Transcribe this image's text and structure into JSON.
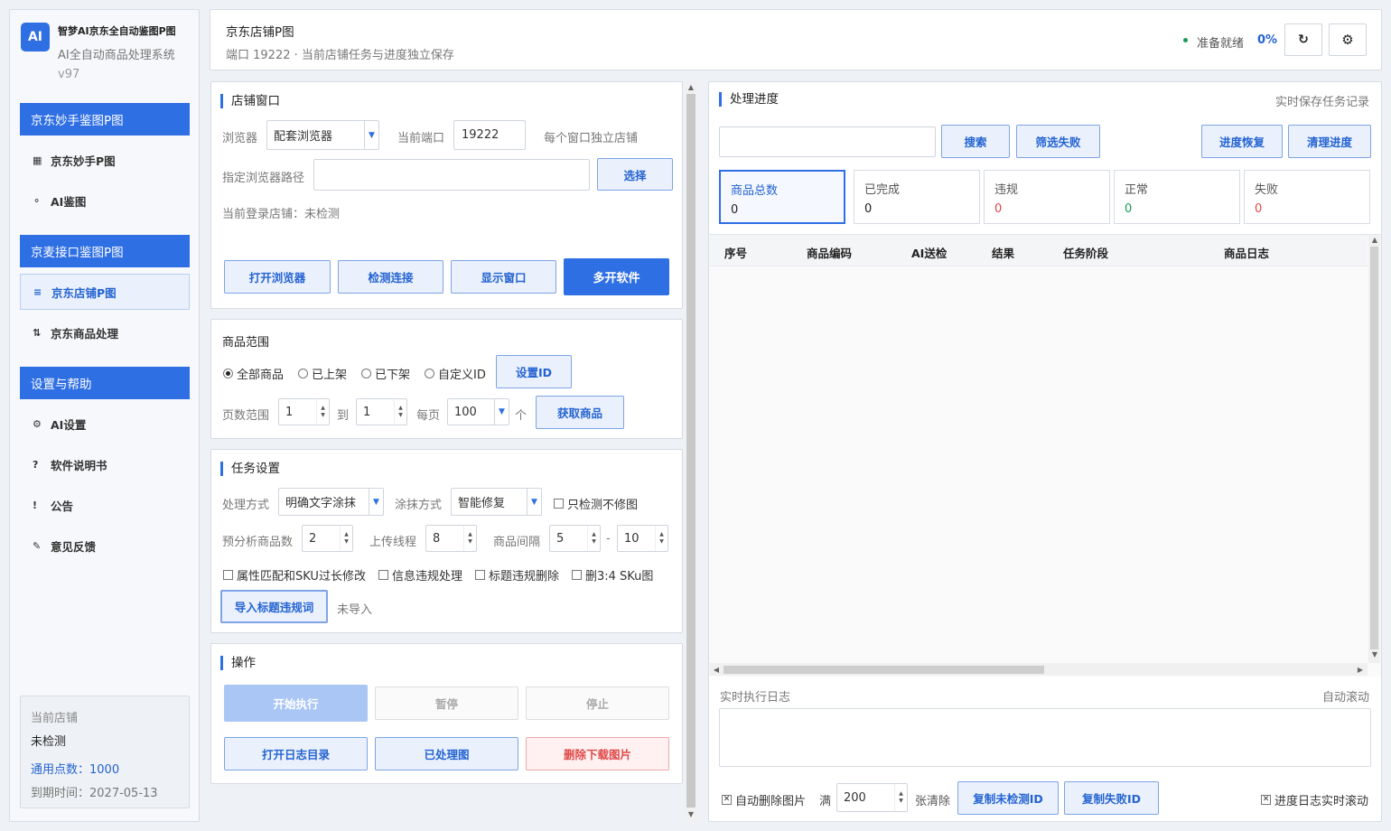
{
  "app": {
    "logo": "AI",
    "title": "智梦AI京东全自动鉴图P图",
    "subtitle": "AI全自动商品处理系统",
    "version": "v97"
  },
  "nav": {
    "group1": {
      "label": "京东妙手鉴图P图",
      "items": [
        {
          "icon": "▦",
          "icon_name": "grid-icon",
          "label": "京东妙手P图"
        },
        {
          "icon": "⚬",
          "icon_name": "circle-icon",
          "label": "AI鉴图"
        }
      ]
    },
    "group2": {
      "label": "京麦接口鉴图P图",
      "items": [
        {
          "icon": "≡",
          "icon_name": "list-icon",
          "label": "京东店铺P图"
        },
        {
          "icon": "⇅",
          "icon_name": "sort-icon",
          "label": "京东商品处理"
        }
      ]
    },
    "group3": {
      "label": "设置与帮助",
      "items": [
        {
          "icon": "⚙",
          "icon_name": "gear-icon",
          "label": "AI设置"
        },
        {
          "icon": "?",
          "icon_name": "help-icon",
          "label": "软件说明书"
        },
        {
          "icon": "!",
          "icon_name": "notice-icon",
          "label": "公告"
        },
        {
          "icon": "✎",
          "icon_name": "feedback-icon",
          "label": "意见反馈"
        }
      ]
    }
  },
  "store_info": {
    "title": "当前店铺",
    "value": "未检测",
    "points": "通用点数：1000",
    "expiry": "到期时间：2027-05-13"
  },
  "header": {
    "title": "京东店铺P图",
    "subtitle": "端口 19222 · 当前店铺任务与进度独立保存",
    "status": "准备就绪",
    "percent": "0%",
    "refresh_icon": "↻",
    "settings_icon": "⚙"
  },
  "store_window": {
    "title": "店铺窗口",
    "browser_label": "浏览器",
    "browser_value": "配套浏览器",
    "port_label": "当前端口",
    "port_value": "19222",
    "note": "每个窗口独立店铺",
    "path_label": "指定浏览器路径",
    "path_value": "",
    "choose_btn": "选择",
    "login_status": "当前登录店铺：未检测",
    "buttons": [
      "打开浏览器",
      "检测连接",
      "显示窗口",
      "多开软件"
    ]
  },
  "range": {
    "title": "商品范围",
    "options": [
      "全部商品",
      "已上架",
      "已下架",
      "自定义ID"
    ],
    "selected": 0,
    "set_id_btn": "设置ID",
    "page_label": "页数范围",
    "page_from": "1",
    "to_label": "到",
    "page_to": "1",
    "per_label": "每页",
    "per_value": "100",
    "unit": "个",
    "fetch_btn": "获取商品"
  },
  "task": {
    "title": "任务设置",
    "mode_label": "处理方式",
    "mode_value": "明确文字涂抹",
    "erase_label": "涂抹方式",
    "erase_value": "智能修复",
    "detect_only": "只检测不修图",
    "pre_label": "预分析商品数",
    "pre_value": "2",
    "thread_label": "上传线程",
    "thread_value": "8",
    "interval_label": "商品间隔",
    "interval_min": "5",
    "dash": "-",
    "interval_max": "10",
    "checks": [
      "属性匹配和SKU过长修改",
      "信息违规处理",
      "标题违规删除",
      "删3:4 SKu图"
    ],
    "import_btn": "导入标题违规词",
    "import_status": "未导入"
  },
  "ops": {
    "title": "操作",
    "start": "开始执行",
    "pause": "暂停",
    "stop": "停止",
    "open_log": "打开日志目录",
    "processed": "已处理图",
    "delete_dl": "删除下载图片"
  },
  "progress": {
    "title": "处理进度",
    "realtime_note": "实时保存任务记录",
    "search_value": "",
    "search_btn": "搜索",
    "filter_btn": "筛选失败",
    "restore_btn": "进度恢复",
    "clear_btn": "清理进度",
    "stats": [
      {
        "label": "商品总数",
        "value": "0",
        "color": "#222222"
      },
      {
        "label": "已完成",
        "value": "0",
        "color": "#222222"
      },
      {
        "label": "违规",
        "value": "0",
        "color": "#e04848"
      },
      {
        "label": "正常",
        "value": "0",
        "color": "#1a9a5a"
      },
      {
        "label": "失败",
        "value": "0",
        "color": "#e04848"
      }
    ],
    "columns": [
      "序号",
      "商品编码",
      "AI送检",
      "结果",
      "任务阶段",
      "商品日志"
    ],
    "rows": [],
    "log_title": "实时执行日志",
    "auto_scroll": "自动滚动",
    "auto_delete": "自动删除图片",
    "full_label": "满",
    "full_value": "200",
    "clear_unit": "张清除",
    "copy_unchecked": "复制未检测ID",
    "copy_failed": "复制失败ID",
    "log_scroll": "进度日志实时滚动"
  },
  "colors": {
    "accent": "#2f6fe4",
    "status_dot": "#1a9a5a",
    "danger": "#e04848"
  }
}
